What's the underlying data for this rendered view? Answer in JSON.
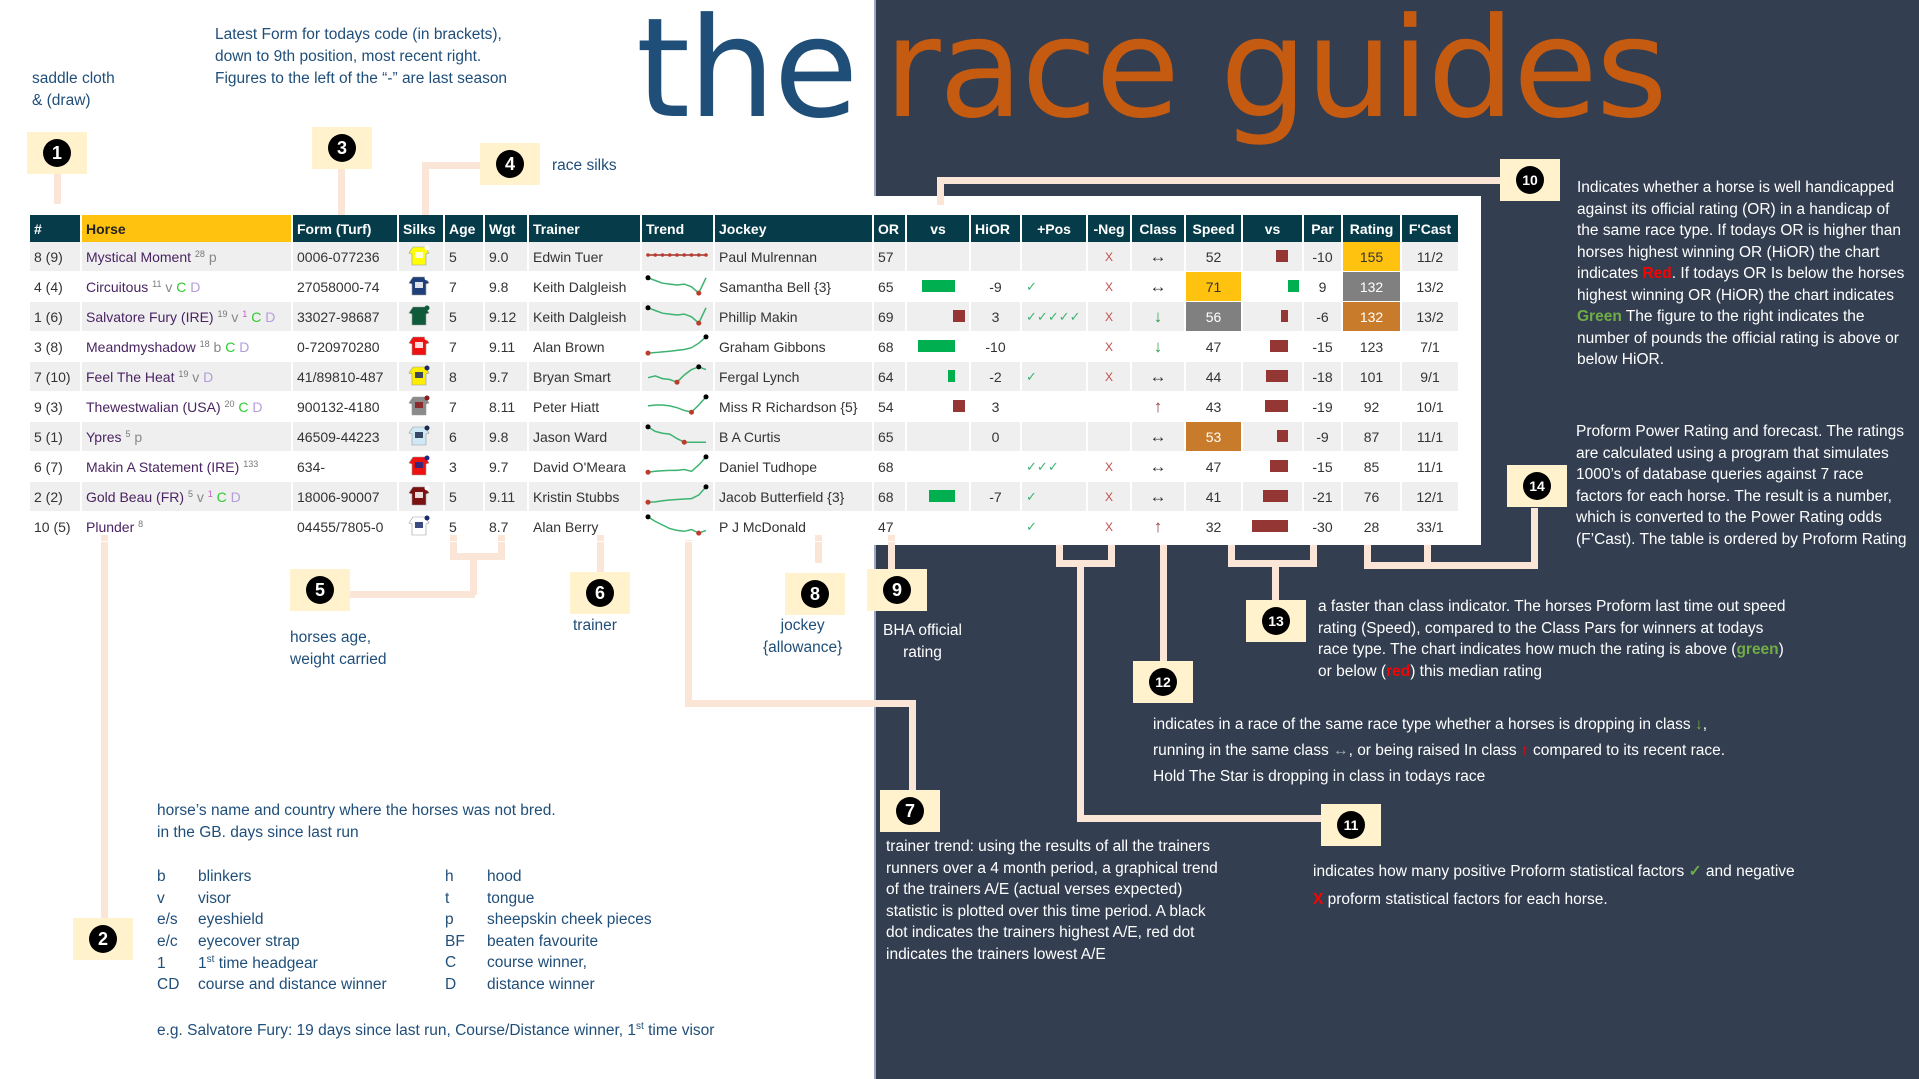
{
  "title": {
    "the": "the",
    "race_guides": "race guides"
  },
  "colors": {
    "header": "#063c4a",
    "horse_header": "#ffc20e",
    "yellow": "#ffc20e",
    "grey": "#808080",
    "orange": "#c97b2c",
    "bar_green": "#00b050",
    "bar_red": "#943634",
    "panel": "#333e50"
  },
  "notes": {
    "saddle": "saddle cloth\n & (draw)",
    "form": "Latest Form for todays code (in brackets),\ndown to 9th position, most recent right.\nFigures to the left of the “-” are last season",
    "silks": "race silks",
    "age": "horses age,\nweight carried",
    "trainer": "trainer",
    "jockey": "jockey\n{allowance}",
    "or": "BHA official\nrating",
    "horse": "horse’s name and country where the horses was not bred.\nin the GB. days since last run",
    "example_pre": "e.g. Salvatore Fury: 19 days since last run, Course/Distance winner, 1",
    "example_sup": "st",
    "example_post": " time visor",
    "n7": "trainer trend: using the results of all the trainers runners over a 4 month period, a graphical trend of the trainers A/E (actual verses expected) statistic is plotted over this time period. A black dot indicates the trainers highest A/E, red dot indicates the trainers lowest A/E",
    "n10_a": "Indicates whether a horse is well handicapped against its official rating (OR) in a handicap of the same race type. If todays OR is higher than horses highest winning OR (HiOR) the chart indicates ",
    "n10_red": "Red",
    "n10_b": ". If todays OR Is below the horses highest winning OR (HiOR) the chart indicates ",
    "n10_green": "Green",
    "n10_c": " The figure to the right indicates the number of pounds the official rating is above or below HiOR.",
    "n11_a": "indicates how many positive Proform statistical factors ",
    "n11_b": " and negative",
    "n11_c": " proform  statistical factors for each horse.",
    "n12_a": "indicates in a race of the same race type whether  a horses is dropping in class ",
    "n12_b": ",",
    "n12_c": "running in the same class ",
    "n12_d": ", or being raised In class ",
    "n12_e": " compared to its recent race.",
    "n12_f": "Hold The Star is dropping in class in todays race",
    "n13_a": "a faster than class indicator. The horses Proform last time out speed rating  (Speed),  compared to the Class Pars for  winners at todays race type. The chart indicates how much the rating is above (",
    "n13_green": "green",
    "n13_b": ") or below (",
    "n13_red": "red",
    "n13_c": ") this median rating",
    "n14": "Proform Power Rating and forecast. The ratings are calculated using a program that simulates 1000’s of database queries against 7 race factors for each horse. The result is a number, which is converted to the Power Rating odds (F’Cast). The table is ordered by Proform Rating"
  },
  "legend": [
    {
      "k": "b",
      "v": "blinkers"
    },
    {
      "k": "v",
      "v": "visor"
    },
    {
      "k": "e/s",
      "v": "eyeshield"
    },
    {
      "k": "e/c",
      "v": "eyecover strap"
    },
    {
      "k": "1",
      "v": "time headgear",
      "sup": "st",
      "pre": "1"
    },
    {
      "k": "CD",
      "v": "course and distance winner"
    },
    {
      "k": "h",
      "v": "hood"
    },
    {
      "k": "t",
      "v": "tongue"
    },
    {
      "k": "p",
      "v": "sheepskin cheek pieces"
    },
    {
      "k": "BF",
      "v": "beaten favourite"
    },
    {
      "k": "C",
      "v": "course winner,"
    },
    {
      "k": "D",
      "v": "distance winner"
    }
  ],
  "callouts": [
    "1",
    "2",
    "3",
    "4",
    "5",
    "6",
    "7",
    "8",
    "9",
    "10",
    "11",
    "12",
    "13",
    "14"
  ],
  "symbols": {
    "check": "✓",
    "cross": "X",
    "same": "↔",
    "down": "↓",
    "up": "↑"
  },
  "columns": [
    "#",
    "Horse",
    "Form (Turf)",
    "Silks",
    "Age",
    "Wgt",
    "Trainer",
    "Trend",
    "Jockey",
    "OR",
    "vs",
    "HiOR",
    "+Pos",
    "-Neg",
    "Class",
    "Speed",
    "vs",
    "Par",
    "Rating",
    "F'Cast"
  ],
  "rows": [
    {
      "no": "8 (9)",
      "name": "Mystical Moment",
      "days": "28",
      "gear": "p",
      "first": "",
      "c": "",
      "d": "",
      "form": "0006-077236",
      "silks": [
        "#ffff00",
        "#ffffff"
      ],
      "age": "5",
      "wgt": "9.0",
      "trainer": "Edwin Tuer",
      "trend": [
        0.5,
        0.5,
        0.5,
        0.5,
        0.5,
        0.5,
        0.5,
        0.5,
        0.5
      ],
      "jockey": "Paul Mulrennan",
      "or": "57",
      "hior": "",
      "pos": 0,
      "neg": true,
      "cls": "same",
      "speed": "52",
      "speed_hl": "",
      "par": "-10",
      "rating": "155",
      "rating_hl": "yellow",
      "fcast": "11/2"
    },
    {
      "no": "4 (4)",
      "name": "Circuitous",
      "days": "11",
      "gear": "v",
      "first": "",
      "c": "C",
      "d": "D",
      "form": "27058000-74",
      "silks": [
        "#1f3f7a",
        "#ffffff"
      ],
      "age": "7",
      "wgt": "9.8",
      "trainer": "Keith Dalgleish",
      "trend": [
        0.9,
        0.75,
        0.6,
        0.55,
        0.5,
        0.55,
        0.4,
        0.05,
        0.9
      ],
      "jockey": "Samantha Bell {3}",
      "or": "65",
      "hior": "-9",
      "pos": 1,
      "neg": true,
      "cls": "same",
      "speed": "71",
      "speed_hl": "yellow",
      "par": "9",
      "rating": "132",
      "rating_hl": "grey",
      "fcast": "13/2"
    },
    {
      "no": "1 (6)",
      "name": "Salvatore Fury (IRE)",
      "days": "19",
      "gear": "v",
      "first": "1",
      "c": "C",
      "d": "D",
      "form": "33027-98687",
      "silks": [
        "#0e5a3a",
        "#0e5a3a"
      ],
      "age": "5",
      "wgt": "9.12",
      "trainer": "Keith Dalgleish",
      "trend": [
        0.9,
        0.75,
        0.6,
        0.55,
        0.5,
        0.55,
        0.4,
        0.05,
        0.9
      ],
      "jockey": "Phillip Makin",
      "or": "69",
      "hior": "3",
      "pos": 5,
      "neg": true,
      "cls": "down",
      "speed": "56",
      "speed_hl": "grey",
      "par": "-6",
      "rating": "132",
      "rating_hl": "orange",
      "fcast": "13/2"
    },
    {
      "no": "3 (8)",
      "name": "Meandmyshadow",
      "days": "18",
      "gear": "b",
      "first": "",
      "c": "C",
      "d": "D",
      "form": "0-720970280",
      "silks": [
        "#ee1111",
        "#ffffff"
      ],
      "age": "7",
      "wgt": "9.11",
      "trainer": "Alan Brown",
      "trend": [
        0.05,
        0.08,
        0.12,
        0.15,
        0.2,
        0.25,
        0.35,
        0.6,
        0.95
      ],
      "jockey": "Graham Gibbons",
      "or": "68",
      "hior": "-10",
      "pos": 0,
      "neg": true,
      "cls": "down",
      "speed": "47",
      "speed_hl": "",
      "par": "-15",
      "rating": "123",
      "rating_hl": "",
      "fcast": "7/1"
    },
    {
      "no": "7 (10)",
      "name": "Feel The Heat",
      "days": "19",
      "gear": "v",
      "first": "",
      "c": "",
      "d": "D",
      "form": "41/89810-487",
      "silks": [
        "#ffee00",
        "#1a2a6a"
      ],
      "age": "8",
      "wgt": "9.7",
      "trainer": "Bryan Smart",
      "trend": [
        0.35,
        0.45,
        0.3,
        0.25,
        0.1,
        0.5,
        0.8,
        0.95,
        0.8
      ],
      "jockey": "Fergal Lynch",
      "or": "64",
      "hior": "-2",
      "pos": 1,
      "neg": true,
      "cls": "same",
      "speed": "44",
      "speed_hl": "",
      "par": "-18",
      "rating": "101",
      "rating_hl": "",
      "fcast": "9/1"
    },
    {
      "no": "9 (3)",
      "name": "Thewestwalian (USA)",
      "days": "20",
      "gear": "",
      "first": "",
      "c": "C",
      "d": "D",
      "form": "900132-4180",
      "silks": [
        "#8a8a8a",
        "#8b1a1a"
      ],
      "age": "7",
      "wgt": "8.11",
      "trainer": "Peter Hiatt",
      "trend": [
        0.45,
        0.5,
        0.5,
        0.45,
        0.35,
        0.2,
        0.1,
        0.5,
        0.95
      ],
      "jockey": "Miss R Richardson {5}",
      "or": "54",
      "hior": "3",
      "pos": 0,
      "neg": false,
      "cls": "up",
      "speed": "43",
      "speed_hl": "",
      "par": "-19",
      "rating": "92",
      "rating_hl": "",
      "fcast": "10/1"
    },
    {
      "no": "5 (1)",
      "name": "Ypres",
      "days": "5",
      "gear": "p",
      "first": "",
      "c": "",
      "d": "",
      "form": "46509-44223",
      "silks": [
        "#cfe8f5",
        "#1a2a4a"
      ],
      "age": "6",
      "wgt": "9.8",
      "trainer": "Jason Ward",
      "trend": [
        0.95,
        0.7,
        0.6,
        0.55,
        0.3,
        0.1,
        0.1,
        0.1,
        0.1
      ],
      "jockey": "B A Curtis",
      "or": "65",
      "hior": "0",
      "pos": 0,
      "neg": false,
      "cls": "same",
      "speed": "53",
      "speed_hl": "orange",
      "par": "-9",
      "rating": "87",
      "rating_hl": "",
      "fcast": "11/1"
    },
    {
      "no": "6 (7)",
      "name": "Makin A Statement (IRE)",
      "days": "133",
      "gear": "",
      "first": "",
      "c": "",
      "d": "",
      "form": "634-",
      "silks": [
        "#ee1111",
        "#1a2a8a"
      ],
      "age": "3",
      "wgt": "9.7",
      "trainer": "David O'Meara",
      "trend": [
        0.1,
        0.15,
        0.18,
        0.2,
        0.2,
        0.25,
        0.15,
        0.5,
        0.95
      ],
      "jockey": "Daniel Tudhope",
      "or": "68",
      "hior": "",
      "pos": 3,
      "neg": true,
      "cls": "same",
      "speed": "47",
      "speed_hl": "",
      "par": "-15",
      "rating": "85",
      "rating_hl": "",
      "fcast": "11/1"
    },
    {
      "no": "2 (2)",
      "name": "Gold Beau (FR)",
      "days": "5",
      "gear": "v",
      "first": "1",
      "c": "C",
      "d": "D",
      "form": "18006-90007",
      "silks": [
        "#7a1010",
        "#ffffff"
      ],
      "age": "5",
      "wgt": "9.11",
      "trainer": "Kristin Stubbs",
      "trend": [
        0.1,
        0.12,
        0.18,
        0.22,
        0.25,
        0.28,
        0.3,
        0.5,
        0.95
      ],
      "jockey": "Jacob Butterfield {3}",
      "or": "68",
      "hior": "-7",
      "pos": 1,
      "neg": true,
      "cls": "same",
      "speed": "41",
      "speed_hl": "",
      "par": "-21",
      "rating": "76",
      "rating_hl": "",
      "fcast": "12/1"
    },
    {
      "no": "10 (5)",
      "name": "Plunder",
      "days": "8",
      "gear": "",
      "first": "",
      "c": "",
      "d": "",
      "form": "04455/7805-0",
      "silks": [
        "#ffffff",
        "#1a2a6a"
      ],
      "age": "5",
      "wgt": "8.7",
      "trainer": "Alan Berry",
      "trend": [
        0.95,
        0.7,
        0.5,
        0.3,
        0.2,
        0.15,
        0.25,
        0.05,
        0.2
      ],
      "jockey": "P J McDonald",
      "or": "47",
      "hior": "",
      "pos": 1,
      "neg": true,
      "cls": "up",
      "speed": "32",
      "speed_hl": "",
      "par": "-30",
      "rating": "28",
      "rating_hl": "",
      "fcast": "33/1"
    }
  ]
}
